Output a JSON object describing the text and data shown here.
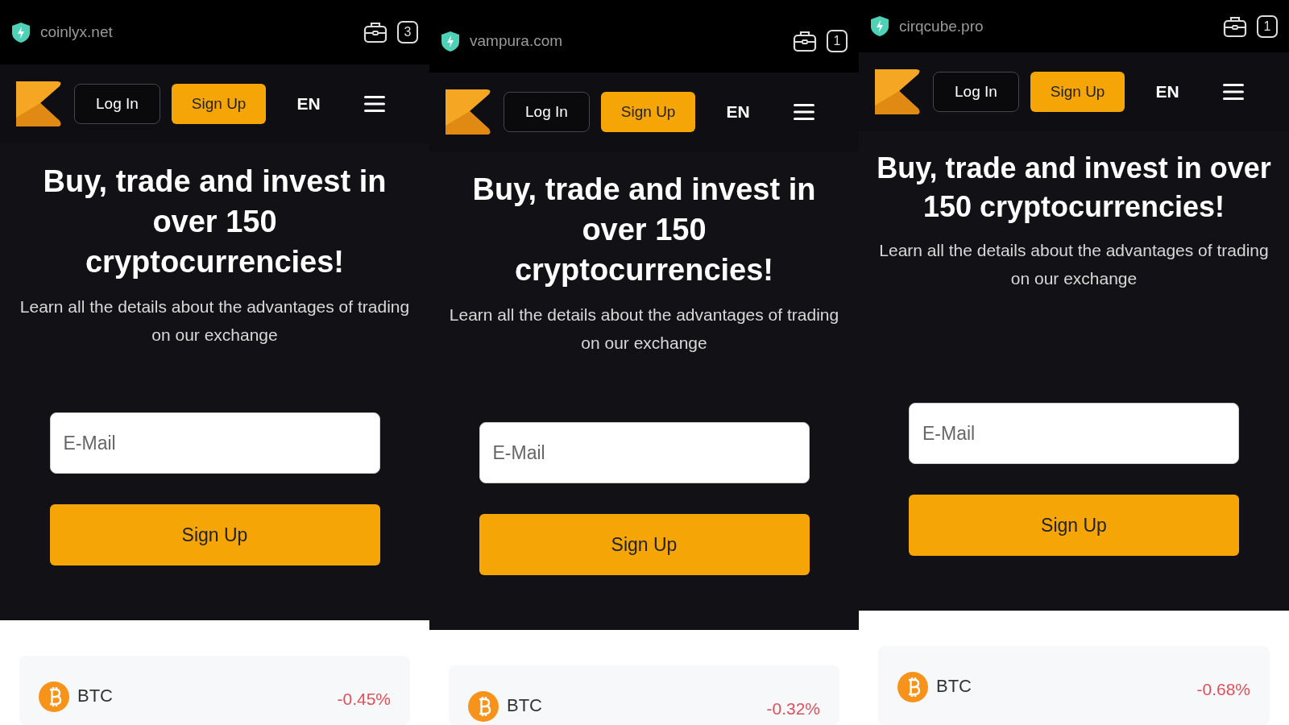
{
  "panels": [
    {
      "url": "coinlyx.net",
      "tab_count": "3",
      "login": "Log In",
      "signup": "Sign Up",
      "language": "EN",
      "headline": "Buy, trade and invest in over 150 cryptocurrencies!",
      "subtitle": "Learn all the details about the advantages of trading on our exchange",
      "email_placeholder": "E-Mail",
      "cta": "Sign Up",
      "ticker": {
        "symbol": "BTC",
        "change": "-0.45%"
      }
    },
    {
      "url": "vampura.com",
      "tab_count": "1",
      "login": "Log In",
      "signup": "Sign Up",
      "language": "EN",
      "headline": "Buy, trade and invest in over 150 cryptocurrencies!",
      "subtitle": "Learn all the details about the advantages of trading on our exchange",
      "email_placeholder": "E-Mail",
      "cta": "Sign Up",
      "ticker": {
        "symbol": "BTC",
        "change": "-0.32%"
      }
    },
    {
      "url": "cirqcube.pro",
      "tab_count": "1",
      "login": "Log In",
      "signup": "Sign Up",
      "language": "EN",
      "headline": "Buy, trade and invest in over 150 cryptocurrencies!",
      "subtitle": "Learn all the details about the advantages of trading on our exchange",
      "email_placeholder": "E-Mail",
      "cta": "Sign Up",
      "ticker": {
        "symbol": "BTC",
        "change": "-0.68%"
      }
    }
  ]
}
